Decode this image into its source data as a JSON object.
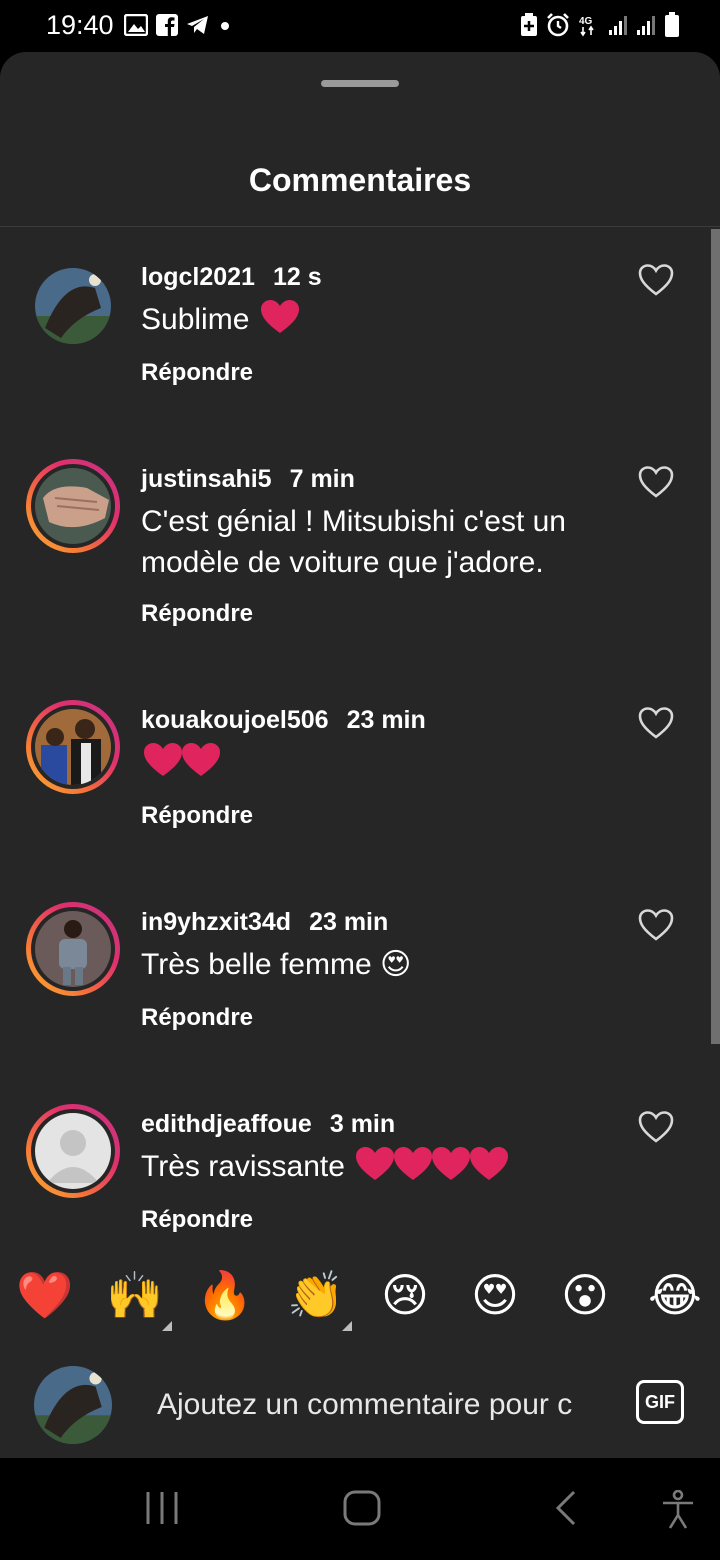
{
  "status_bar": {
    "time": "19:40",
    "left_icons": [
      "gallery-icon",
      "facebook-icon",
      "telegram-icon",
      "dot-icon"
    ],
    "right_icons": [
      "battery-saver-icon",
      "alarm-icon",
      "4g-icon",
      "signal-icon",
      "signal-icon",
      "battery-icon"
    ],
    "network_label": "4G"
  },
  "sheet": {
    "title": "Commentaires"
  },
  "comments": [
    {
      "username": "logcl2021",
      "time": "12 s",
      "text": "Sublime",
      "hearts_after": 1,
      "reply_label": "Répondre",
      "has_story_ring": false,
      "avatar_color": "#3e4e63"
    },
    {
      "username": "justinsahi5",
      "time": "7 min",
      "text": "C'est génial ! Mitsubishi c'est un modèle de voiture que j'adore.",
      "hearts_after": 0,
      "reply_label": "Répondre",
      "has_story_ring": true,
      "avatar_color": "#7a6b5a"
    },
    {
      "username": "kouakoujoel506",
      "time": "23 min",
      "text": "",
      "hearts_after": 2,
      "reply_label": "Répondre",
      "has_story_ring": true,
      "avatar_color": "#8b5a3a"
    },
    {
      "username": "in9yhzxit34d",
      "time": "23 min",
      "text": "Très belle femme",
      "emoji_after": "😍",
      "hearts_after": 0,
      "reply_label": "Répondre",
      "has_story_ring": true,
      "avatar_color": "#5b4a48"
    },
    {
      "username": "edithdjeaffoue",
      "time": "3 min",
      "text": "Très ravissante",
      "hearts_after": 4,
      "reply_label": "Répondre",
      "has_story_ring": true,
      "avatar_color": "#e4e4e4"
    }
  ],
  "reactions": [
    {
      "emoji": "❤️",
      "name": "heart-emoji",
      "has_variants": false
    },
    {
      "emoji": "🙌",
      "name": "raising-hands-emoji",
      "has_variants": true
    },
    {
      "emoji": "🔥",
      "name": "fire-emoji",
      "has_variants": false
    },
    {
      "emoji": "👏",
      "name": "clapping-hands-emoji",
      "has_variants": true
    },
    {
      "emoji": "😢",
      "name": "crying-face-emoji",
      "has_variants": false
    },
    {
      "emoji": "😍",
      "name": "heart-eyes-emoji",
      "has_variants": false
    },
    {
      "emoji": "😮",
      "name": "surprised-face-emoji",
      "has_variants": false
    },
    {
      "emoji": "😂",
      "name": "tears-of-joy-emoji",
      "has_variants": false
    }
  ],
  "composer": {
    "placeholder": "Ajoutez un commentaire pour c",
    "gif_label": "GIF"
  },
  "nav_bar": {
    "icons": [
      "recent-apps-icon",
      "home-icon",
      "back-icon",
      "accessibility-icon"
    ]
  },
  "colors": {
    "sheet_bg": "#262626",
    "heart_red": "#e0245e",
    "ring_start": "#f9b233",
    "ring_end": "#c13584"
  }
}
